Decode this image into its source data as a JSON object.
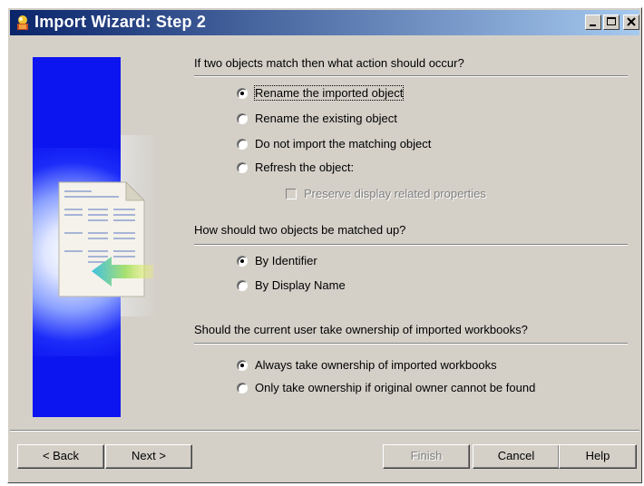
{
  "window": {
    "title": "Import Wizard: Step 2"
  },
  "section1": {
    "question": "If two objects match then what action should occur?",
    "options": [
      {
        "label": "Rename the imported object",
        "selected": true
      },
      {
        "label": "Rename the existing object",
        "selected": false
      },
      {
        "label": "Do not import the matching object",
        "selected": false
      },
      {
        "label": "Refresh the object:",
        "selected": false
      }
    ],
    "suboption": {
      "label": "Preserve display related properties",
      "checked": false,
      "enabled": false
    }
  },
  "section2": {
    "question": "How should two objects be matched up?",
    "options": [
      {
        "label": "By Identifier",
        "selected": true
      },
      {
        "label": "By Display Name",
        "selected": false
      }
    ]
  },
  "section3": {
    "question": "Should the current user take ownership of imported workbooks?",
    "options": [
      {
        "label": "Always take ownership of imported workbooks",
        "selected": true
      },
      {
        "label": "Only take ownership if original owner cannot be found",
        "selected": false
      }
    ]
  },
  "buttons": {
    "back": "< Back",
    "next": "Next >",
    "finish": "Finish",
    "cancel": "Cancel",
    "help": "Help"
  },
  "colors": {
    "titlebar_start": "#0a246a",
    "titlebar_end": "#a6caf0",
    "banner": "#0c14f0",
    "dialog": "#d4d0c8"
  },
  "icons": {
    "app": "wizard-icon",
    "minimize": "minimize-icon",
    "maximize": "maximize-icon",
    "close": "close-icon",
    "banner": "import-document-icon"
  }
}
